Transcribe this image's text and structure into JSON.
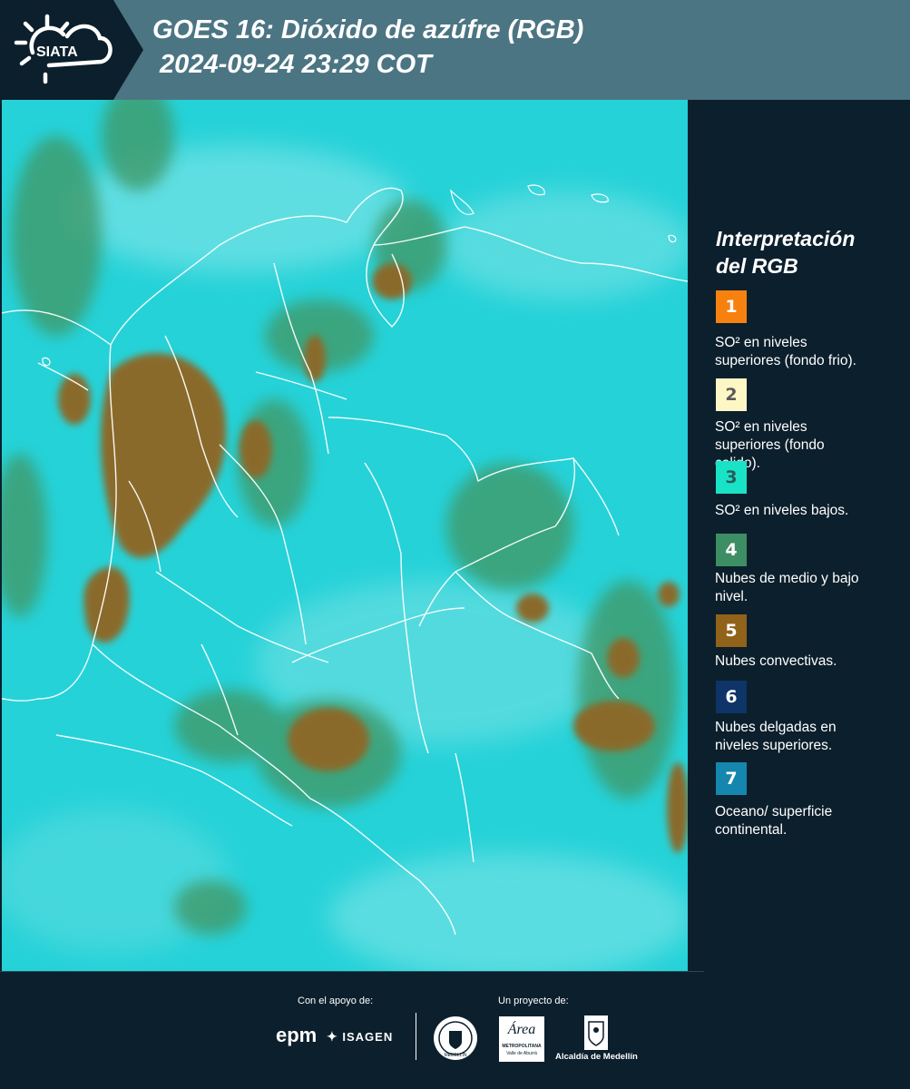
{
  "header": {
    "logo_text": "SIATA",
    "title_line1": "GOES 16: Dióxido de azúfre (RGB)",
    "title_line2": " 2024-09-24 23:29 COT"
  },
  "legend": {
    "title_line1": "Interpretación",
    "title_line2": "del RGB",
    "items": [
      {
        "number": "1",
        "color": "#f7810f",
        "text_color": "#ffffff",
        "lines": [
          "SO² en niveles",
          "superiores (fondo frio)."
        ]
      },
      {
        "number": "2",
        "color": "#fdf7c6",
        "text_color": "#5a5a5a",
        "lines": [
          "SO² en niveles",
          "superiores (fondo",
          "calido)."
        ]
      },
      {
        "number": "3",
        "color": "#19e3c6",
        "text_color": "#2b5a5a",
        "lines": [
          "SO² en niveles bajos."
        ]
      },
      {
        "number": "4",
        "color": "#3d8e64",
        "text_color": "#ffffff",
        "lines": [
          "Nubes de medio y bajo",
          "nivel."
        ]
      },
      {
        "number": "5",
        "color": "#91621a",
        "text_color": "#ffffff",
        "lines": [
          "Nubes convectivas."
        ]
      },
      {
        "number": "6",
        "color": "#0e3468",
        "text_color": "#ffffff",
        "lines": [
          "Nubes delgadas en",
          "niveles superiores."
        ]
      },
      {
        "number": "7",
        "color": "#1586ae",
        "text_color": "#ffffff",
        "lines": [
          "Oceano/ superficie",
          "continental."
        ]
      }
    ]
  },
  "footer": {
    "support_label": "Con el apoyo de:",
    "project_label": "Un proyecto de:",
    "sponsors": {
      "epm": "epm",
      "isagen": "ISAGEN",
      "area_name": "Área",
      "area_sub1": "METROPOLITANA",
      "area_sub2": "Valle de Aburrá",
      "alcaldia": "Alcaldía de Medellín",
      "seal_text": "MEDELLÍN"
    }
  },
  "colors": {
    "background": "#0c1f2c",
    "header_band": "#4c7583",
    "map_cyan": "#1fcfd6",
    "convective": "#8a6a2a",
    "mid_low_cloud": "#3f9a5c"
  }
}
